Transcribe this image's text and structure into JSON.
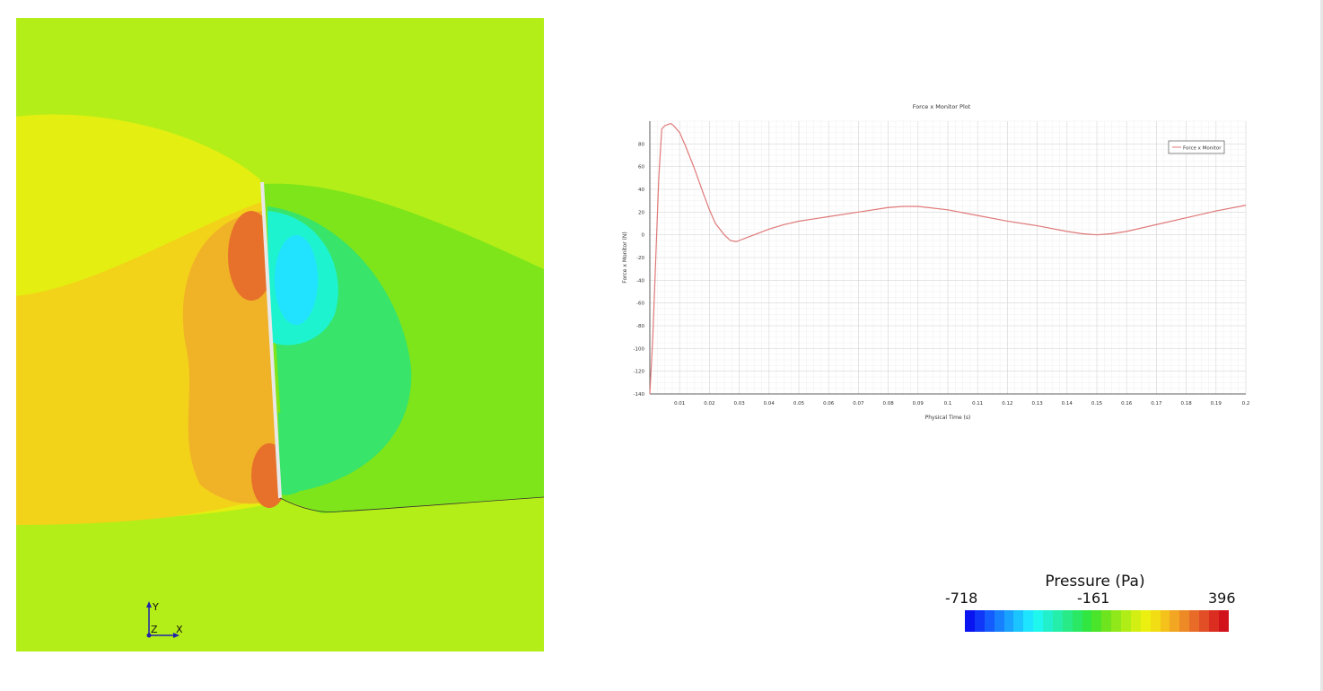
{
  "window": {
    "title": ""
  },
  "contour": {
    "axes": {
      "y": "Y",
      "z": "Z",
      "x": "X"
    },
    "colors": {
      "background": "#b4ee18",
      "upstream_far": "#e4ee10",
      "upstream_mid": "#f3d21a",
      "upstream_high": "#f0b226",
      "stagnation": "#e7702a",
      "wake": "#7ee51a",
      "wake_low": "#38e46a",
      "vortex_core": "#1ef3d0",
      "vortex_center": "#21e2ff",
      "plate": "#e8e8e8"
    }
  },
  "chart_data": {
    "type": "line",
    "title": "Force x Monitor Plot",
    "xlabel": "Physical Time (s)",
    "ylabel": "Force x Monitor (N)",
    "xlim": [
      0.0,
      0.2
    ],
    "ylim": [
      -140,
      100
    ],
    "xticks": [
      0.01,
      0.02,
      0.03,
      0.04,
      0.05,
      0.06,
      0.07,
      0.08,
      0.09,
      0.1,
      0.11,
      0.12,
      0.13,
      0.14,
      0.15,
      0.16,
      0.17,
      0.18,
      0.19,
      0.2
    ],
    "xtick_labels": [
      "0.01",
      "0.02",
      "0.03",
      "0.04",
      "0.05",
      "0.06",
      "0.07",
      "0.08",
      "0.09",
      "0.1",
      "0.11",
      "0.12",
      "0.13",
      "0.14",
      "0.15",
      "0.16",
      "0.17",
      "0.18",
      "0.19",
      "0.2"
    ],
    "yticks": [
      80,
      60,
      40,
      20,
      0,
      -20,
      -40,
      -60,
      -80,
      -100,
      -120,
      -140
    ],
    "ytick_labels": [
      "80",
      "60",
      "40",
      "20",
      "0",
      "-20",
      "-40",
      "-60",
      "-80",
      "-100",
      "-120",
      "-140"
    ],
    "grid": true,
    "legend_position": "top-right",
    "series": [
      {
        "name": "Force x Monitor",
        "color": "#e07878",
        "x": [
          0.0,
          0.001,
          0.002,
          0.003,
          0.004,
          0.005,
          0.006,
          0.007,
          0.008,
          0.01,
          0.012,
          0.015,
          0.018,
          0.02,
          0.022,
          0.025,
          0.027,
          0.029,
          0.03,
          0.032,
          0.035,
          0.04,
          0.045,
          0.05,
          0.055,
          0.06,
          0.07,
          0.08,
          0.085,
          0.09,
          0.1,
          0.11,
          0.12,
          0.13,
          0.14,
          0.145,
          0.15,
          0.155,
          0.16,
          0.17,
          0.18,
          0.19,
          0.2
        ],
        "y": [
          -140,
          -90,
          -20,
          50,
          93,
          96,
          97,
          98,
          96,
          90,
          78,
          58,
          36,
          22,
          10,
          0,
          -5,
          -6,
          -5,
          -3,
          0,
          5,
          9,
          12,
          14,
          16,
          20,
          24,
          25,
          25,
          22,
          17,
          12,
          8,
          3,
          1,
          0,
          1,
          3,
          9,
          15,
          21,
          26
        ]
      }
    ]
  },
  "scale": {
    "title": "Pressure (Pa)",
    "min_label": "-718",
    "mid_label": "-161",
    "max_label": "396",
    "colors": [
      "#0a14f0",
      "#1036f8",
      "#155cff",
      "#1780ff",
      "#1aa2ff",
      "#1cc4ff",
      "#1ee4ff",
      "#1ff6ee",
      "#22f0cc",
      "#25eeaa",
      "#28ea86",
      "#2be864",
      "#31e640",
      "#4ae42a",
      "#6ee41e",
      "#90e81a",
      "#b0ec16",
      "#d2ee12",
      "#ecf010",
      "#f2dc14",
      "#f4c21a",
      "#f2a622",
      "#ee8a26",
      "#e86c28",
      "#e24e26",
      "#dc2e20",
      "#d2121a"
    ]
  }
}
